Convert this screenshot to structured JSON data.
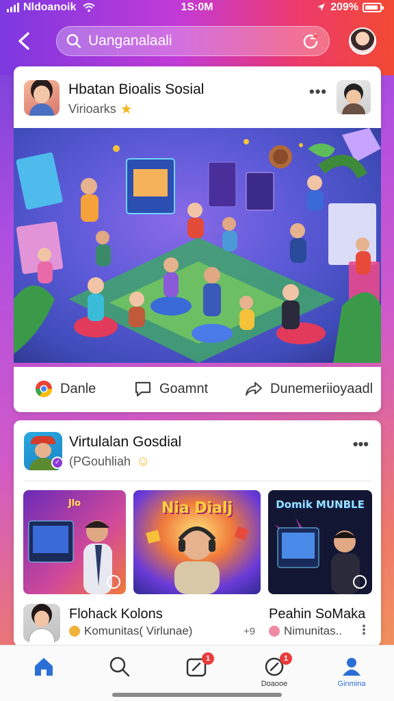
{
  "status_bar": {
    "carrier": "Nldoanoik",
    "time": "1S:0M",
    "battery": "209%"
  },
  "search": {
    "placeholder": "Uanganalaali"
  },
  "post1": {
    "name": "Hbatan Bioalis Sosial",
    "subtitle": "Virioarks"
  },
  "actions": {
    "like": "Danle",
    "comment": "Goamnt",
    "share": "Dunemeriioyaadl"
  },
  "post2": {
    "name": "Virtulalan Gosdial",
    "subtitle": "(PGouhliah"
  },
  "thumbnails": [
    {
      "title": "Jlo"
    },
    {
      "title": "Nia Dialj"
    },
    {
      "title": "Domik MUNBLE"
    }
  ],
  "captions": {
    "left_title": "Flohack Kolons",
    "left_sub": "Komunitas( Virlunae)",
    "left_dots": "+9",
    "right_title": "Peahin SoMaka",
    "right_sub": "Nimunitas.."
  },
  "bottom_nav": {
    "items": [
      {
        "label": "",
        "icon": "home-icon"
      },
      {
        "label": "",
        "icon": "search-icon"
      },
      {
        "label": "",
        "icon": "create-icon",
        "badge": "1"
      },
      {
        "label": "Doaooe",
        "icon": "notifications-icon",
        "badge": "1"
      },
      {
        "label": "Ginmina",
        "icon": "profile-icon"
      }
    ]
  },
  "colors": {
    "accent": "#2b6fd6",
    "badge": "#ea3b3b",
    "header_start": "#7d38e0",
    "header_end": "#f24a32"
  }
}
